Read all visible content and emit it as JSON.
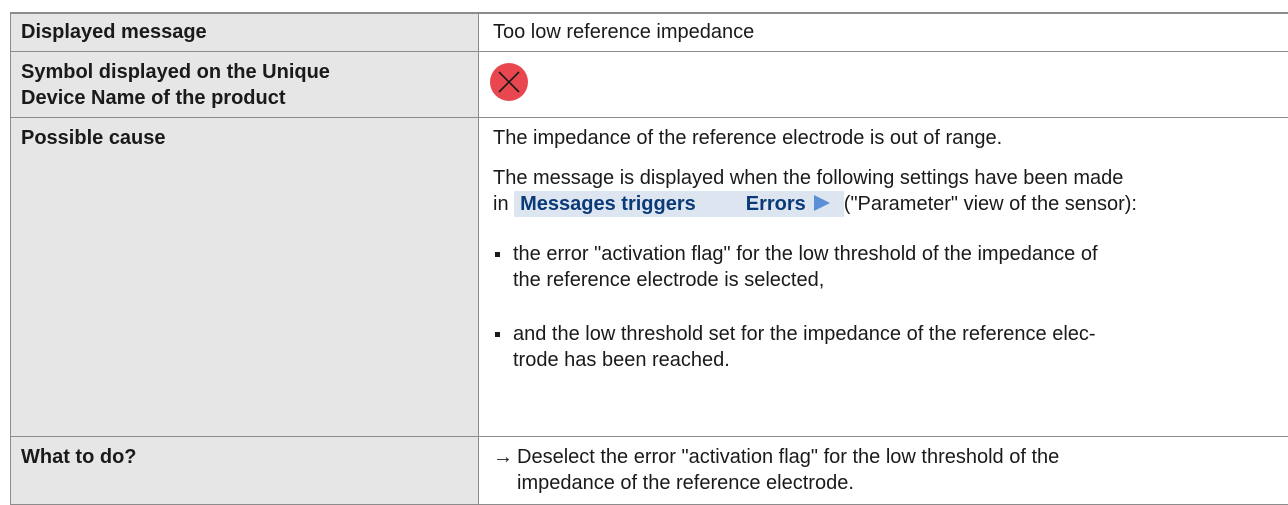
{
  "rows": {
    "message": {
      "label": "Displayed message",
      "value": "Too low reference impedance"
    },
    "symbol": {
      "label_line1": "Symbol displayed on the Unique",
      "label_line2": "Device Name of the product",
      "icon": "error-x-icon",
      "icon_color": "#e8474f"
    },
    "cause": {
      "label": "Possible cause",
      "text1": "The  impedance of the reference electrode is out of range.",
      "text2_line1": "The message is displayed when the following settings have been made",
      "text2_prefix": "in ",
      "path_part1": "Messages triggers",
      "path_part2": "Errors",
      "text2_suffix": "(\"Parameter\" view of the sensor):",
      "bullet1_line1": "the error \"activation flag\" for the low threshold of the impedance of",
      "bullet1_line2": "the reference electrode is selected,",
      "bullet2_line1": "and the low threshold set for the impedance of the reference elec-",
      "bullet2_line2": "trode has been reached."
    },
    "todo": {
      "label": "What to do?",
      "arrow": "→",
      "line1": "Deselect the error \"activation flag\" for the low threshold of the",
      "line2": "impedance of the reference electrode."
    }
  }
}
